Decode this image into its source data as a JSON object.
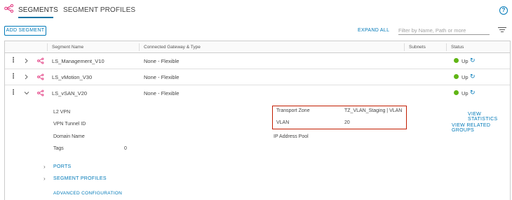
{
  "tabs": [
    "SEGMENTS",
    "SEGMENT PROFILES"
  ],
  "help_icon": "help-icon",
  "toolbar": {
    "add_label": "ADD SEGMENT",
    "expand_all": "EXPAND ALL",
    "filter_placeholder": "Filter by Name, Path or more"
  },
  "columns": {
    "name": "Segment Name",
    "gateway": "Connected Gateway & Type",
    "subnets": "Subnets",
    "status": "Status"
  },
  "rows": [
    {
      "name": "LS_Management_V10",
      "gateway": "None - Flexible",
      "status": "Up",
      "expanded": false
    },
    {
      "name": "LS_vMotion_V30",
      "gateway": "None - Flexible",
      "status": "Up",
      "expanded": false
    },
    {
      "name": "LS_vSAN_V20",
      "gateway": "None - Flexible",
      "status": "Up",
      "expanded": true
    }
  ],
  "detail": {
    "l2vpn_label": "L2 VPN",
    "vpn_tunnel_label": "VPN Tunnel ID",
    "domain_label": "Domain Name",
    "tags_label": "Tags",
    "tags_value": "0",
    "transport_zone_label": "Transport Zone",
    "transport_zone_value": "TZ_VLAN_Staging | VLAN",
    "vlan_label": "VLAN",
    "vlan_value": "20",
    "ip_pool_label": "IP Address Pool",
    "view_statistics": "VIEW STATISTICS",
    "view_related_groups": "VIEW RELATED GROUPS",
    "ports_label": "PORTS",
    "segment_profiles_label": "SEGMENT PROFILES",
    "advanced_config": "ADVANCED CONFIGURATION"
  },
  "colors": {
    "accent": "#0079b8",
    "status_up": "#60b515",
    "highlight": "#c21d00",
    "segment_icon": "#e12f7a"
  },
  "icons": [
    "segment-icon",
    "kebab-icon",
    "chevron-right-icon",
    "chevron-down-icon",
    "refresh-icon",
    "filter-icon",
    "help-icon"
  ]
}
